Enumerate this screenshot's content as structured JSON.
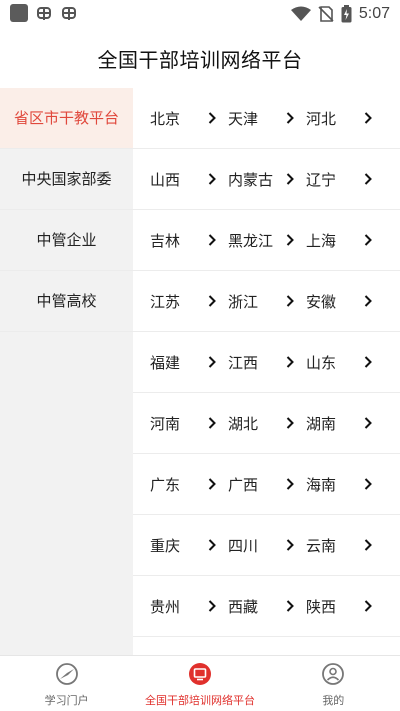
{
  "status_bar": {
    "time": "5:07"
  },
  "header": {
    "title": "全国干部培训网络平台"
  },
  "sidebar": {
    "items": [
      {
        "label": "省区市干教平台",
        "active": true
      },
      {
        "label": "中央国家部委",
        "active": false
      },
      {
        "label": "中管企业",
        "active": false
      },
      {
        "label": "中管高校",
        "active": false
      }
    ]
  },
  "regions": [
    [
      "北京",
      "天津",
      "河北"
    ],
    [
      "山西",
      "内蒙古",
      "辽宁"
    ],
    [
      "吉林",
      "黑龙江",
      "上海"
    ],
    [
      "江苏",
      "浙江",
      "安徽"
    ],
    [
      "福建",
      "江西",
      "山东"
    ],
    [
      "河南",
      "湖北",
      "湖南"
    ],
    [
      "广东",
      "广西",
      "海南"
    ],
    [
      "重庆",
      "四川",
      "云南"
    ],
    [
      "贵州",
      "西藏",
      "陕西"
    ]
  ],
  "tabbar": {
    "items": [
      {
        "label": "学习门户",
        "icon": "compass-icon",
        "active": false
      },
      {
        "label": "全国干部培训网络平台",
        "icon": "monitor-icon",
        "active": true
      },
      {
        "label": "我的",
        "icon": "person-icon",
        "active": false
      }
    ]
  },
  "colors": {
    "accent": "#e0302c",
    "active_bg": "#fbeee8",
    "sidebar_bg": "#f2f2f2"
  }
}
